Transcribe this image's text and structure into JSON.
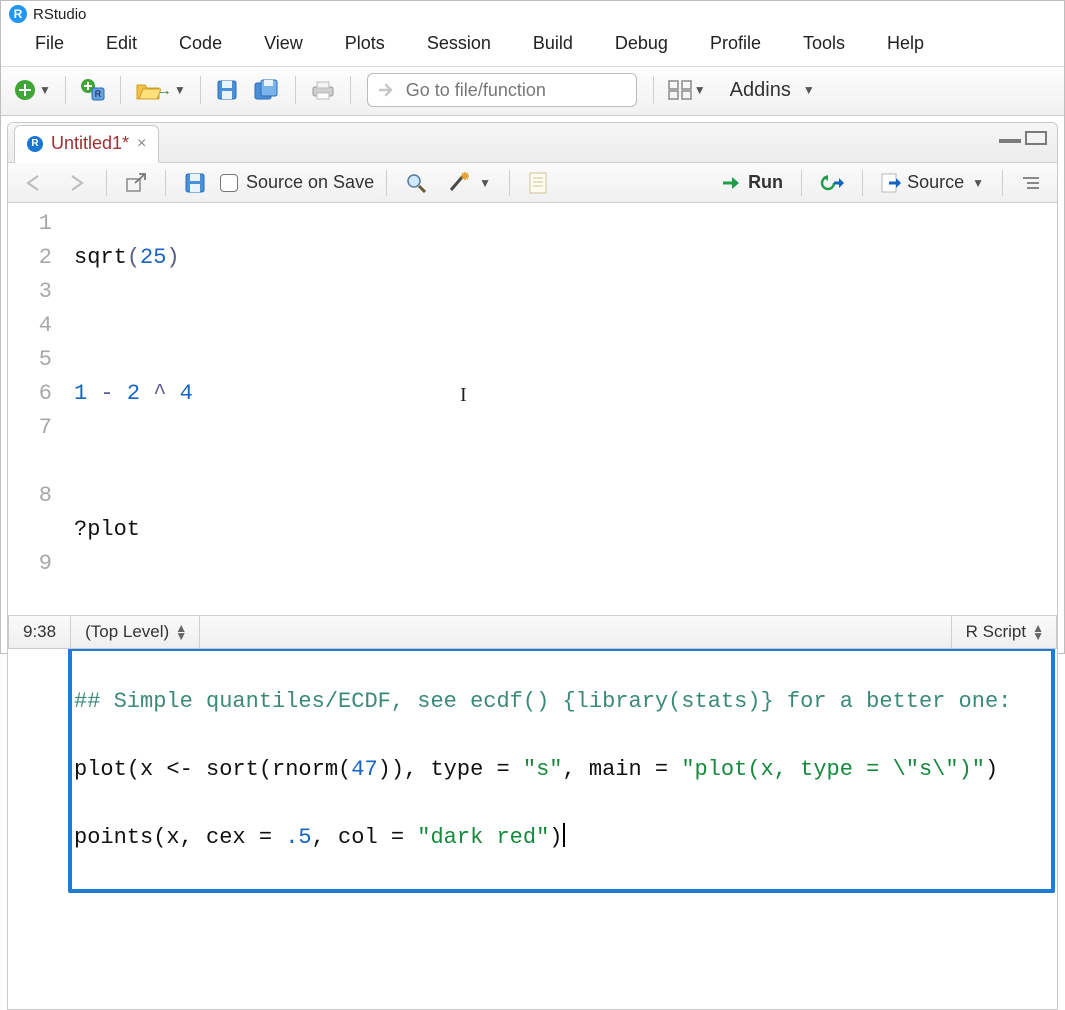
{
  "app": {
    "title": "RStudio"
  },
  "menu": [
    "File",
    "Edit",
    "Code",
    "View",
    "Plots",
    "Session",
    "Build",
    "Debug",
    "Profile",
    "Tools",
    "Help"
  ],
  "toolbar": {
    "goto_placeholder": "Go to file/function",
    "addins_label": "Addins"
  },
  "tab": {
    "name": "Untitled1*"
  },
  "editor_toolbar": {
    "source_on_save": "Source on Save",
    "run": "Run",
    "source": "Source"
  },
  "code": {
    "lines": [
      "1",
      "2",
      "3",
      "4",
      "5",
      "6",
      "7",
      "8",
      "9"
    ],
    "l1_fn": "sqrt",
    "l1_open": "(",
    "l1_num": "25",
    "l1_close": ")",
    "l3_a": "1",
    "l3_op1": "-",
    "l3_b": "2",
    "l3_op2": "^",
    "l3_c": "4",
    "l5": "?plot",
    "l7": "## Simple quantiles/ECDF, see ecdf() {library(stats)} for a better one:",
    "l8_pre": "plot(x <- sort(rnorm(",
    "l8_n": "47",
    "l8_mid1": ")), type = ",
    "l8_s1": "\"s\"",
    "l8_mid2": ", main = ",
    "l8_s2": "\"plot(x, type = \\\"s\\\")\"",
    "l8_end": ")",
    "l9_pre": "points(x, cex = ",
    "l9_n": ".5",
    "l9_mid": ", col = ",
    "l9_s": "\"dark red\"",
    "l9_end": ")"
  },
  "status": {
    "pos": "9:38",
    "scope": "(Top Level)",
    "lang": "R Script"
  }
}
